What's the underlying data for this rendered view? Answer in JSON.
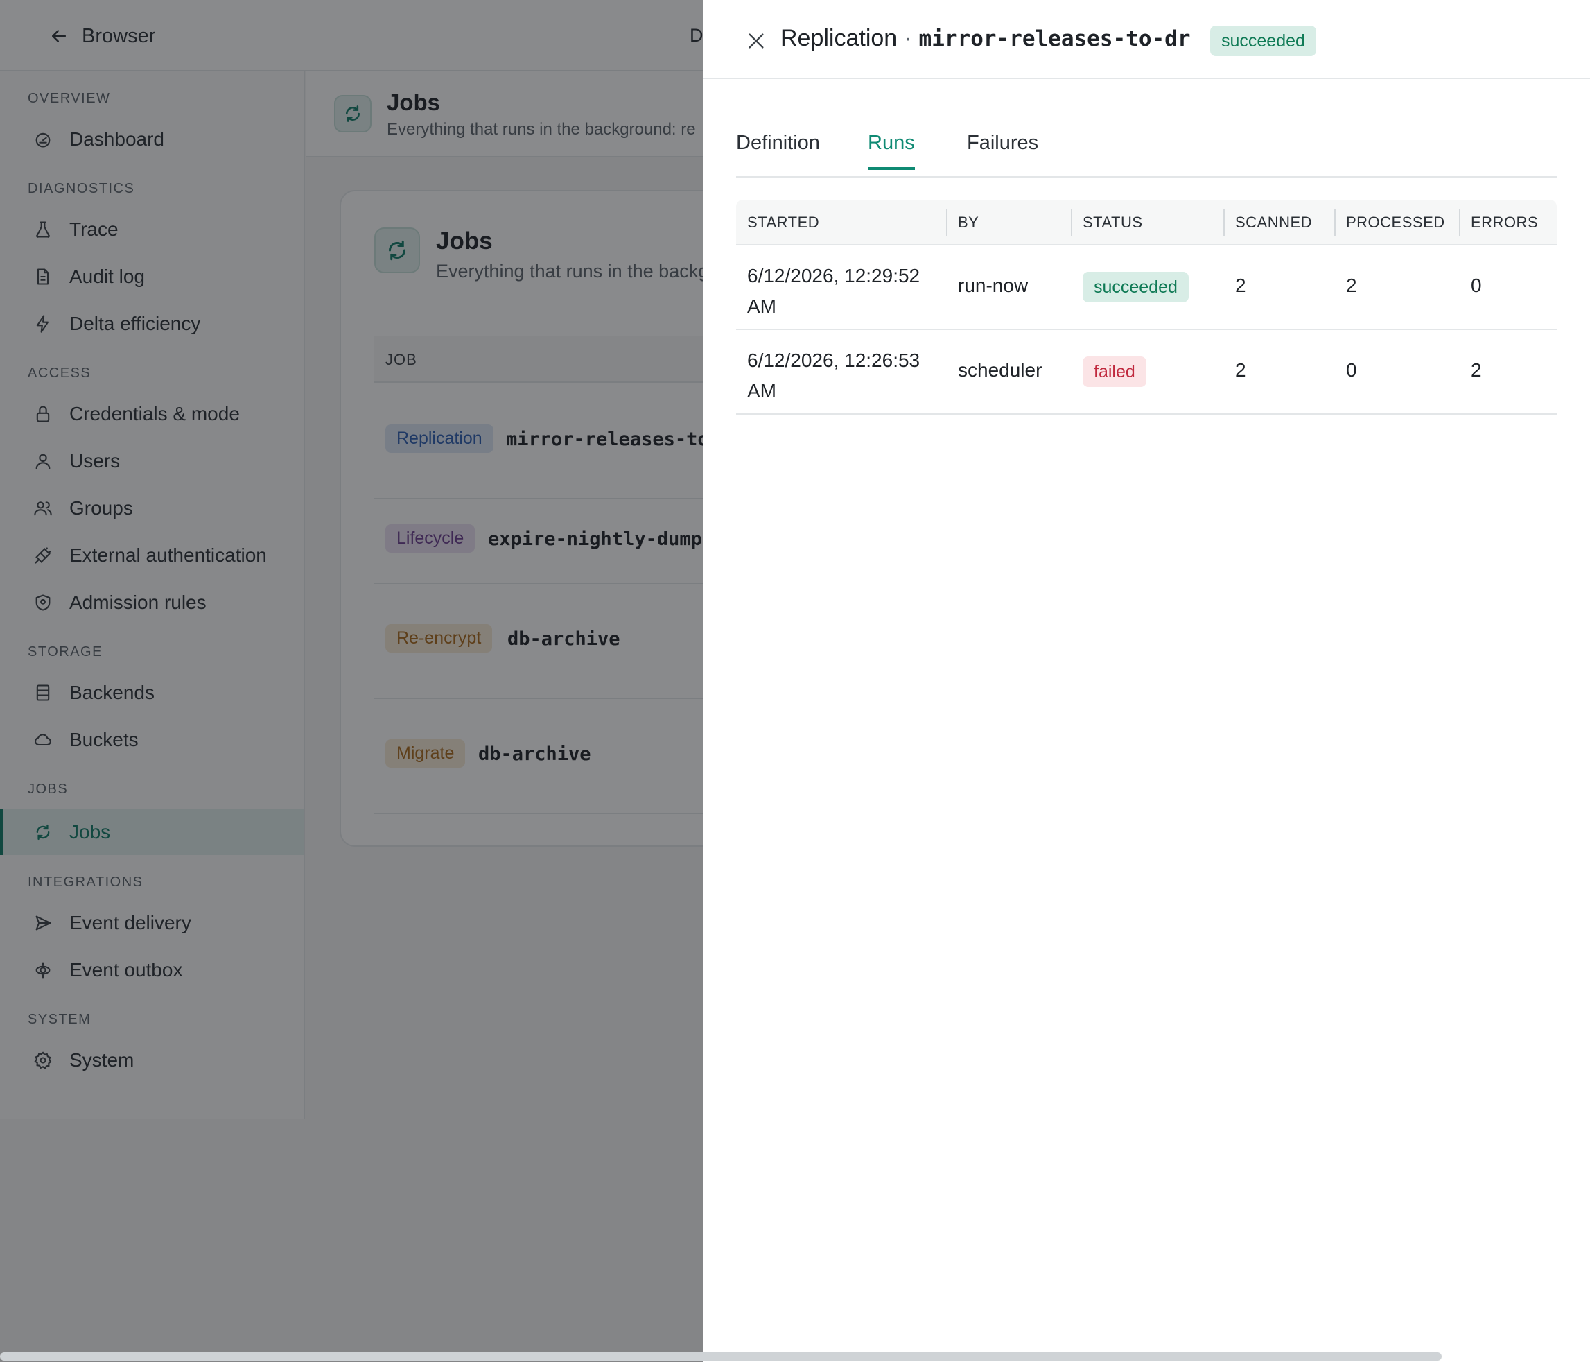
{
  "topbar": {
    "back_label": "Browser",
    "truncated_text": "D"
  },
  "sidebar": {
    "sections": [
      {
        "title": "OVERVIEW",
        "items": [
          {
            "label": "Dashboard",
            "icon": "dashboard-icon"
          }
        ]
      },
      {
        "title": "DIAGNOSTICS",
        "items": [
          {
            "label": "Trace",
            "icon": "flask-icon"
          },
          {
            "label": "Audit log",
            "icon": "document-icon"
          },
          {
            "label": "Delta efficiency",
            "icon": "bolt-icon"
          }
        ]
      },
      {
        "title": "ACCESS",
        "items": [
          {
            "label": "Credentials & mode",
            "icon": "lock-icon"
          },
          {
            "label": "Users",
            "icon": "user-icon"
          },
          {
            "label": "Groups",
            "icon": "users-icon"
          },
          {
            "label": "External authentication",
            "icon": "plug-icon"
          },
          {
            "label": "Admission rules",
            "icon": "shield-icon"
          }
        ]
      },
      {
        "title": "STORAGE",
        "items": [
          {
            "label": "Backends",
            "icon": "server-icon"
          },
          {
            "label": "Buckets",
            "icon": "cloud-icon"
          }
        ]
      },
      {
        "title": "JOBS",
        "items": [
          {
            "label": "Jobs",
            "icon": "refresh-icon",
            "active": true
          }
        ]
      },
      {
        "title": "INTEGRATIONS",
        "items": [
          {
            "label": "Event delivery",
            "icon": "send-icon"
          },
          {
            "label": "Event outbox",
            "icon": "outbox-icon"
          }
        ]
      },
      {
        "title": "SYSTEM",
        "items": [
          {
            "label": "System",
            "icon": "gear-icon"
          }
        ]
      }
    ]
  },
  "main": {
    "title": "Jobs",
    "subtitle": "Everything that runs in the background: re",
    "card": {
      "title": "Jobs",
      "subtitle": "Everything that runs in the backg",
      "column_header": "JOB",
      "rows": [
        {
          "kind": "Replication",
          "name": "mirror-releases-to-"
        },
        {
          "kind": "Lifecycle",
          "name": "expire-nightly-dumps"
        },
        {
          "kind": "Re-encrypt",
          "name": "db-archive"
        },
        {
          "kind": "Migrate",
          "name": "db-archive"
        }
      ]
    }
  },
  "drawer": {
    "title_kind": "Replication",
    "title_sep": "·",
    "title_name": "mirror-releases-to-dr",
    "status": "succeeded",
    "tabs": [
      "Definition",
      "Runs",
      "Failures"
    ],
    "active_tab": "Runs",
    "columns": [
      "STARTED",
      "BY",
      "STATUS",
      "SCANNED",
      "PROCESSED",
      "ERRORS"
    ],
    "runs": [
      {
        "started": "6/12/2026, 12:29:52 AM",
        "by": "run-now",
        "status": "succeeded",
        "scanned": "2",
        "processed": "2",
        "errors": "0"
      },
      {
        "started": "6/12/2026, 12:26:53 AM",
        "by": "scheduler",
        "status": "failed",
        "scanned": "2",
        "processed": "0",
        "errors": "2"
      }
    ]
  },
  "colors": {
    "accent": "#0f8a73",
    "success_bg": "#d8ede6",
    "success_fg": "#0f7a55",
    "failed_bg": "#fbe4e6",
    "failed_fg": "#c0293e"
  }
}
